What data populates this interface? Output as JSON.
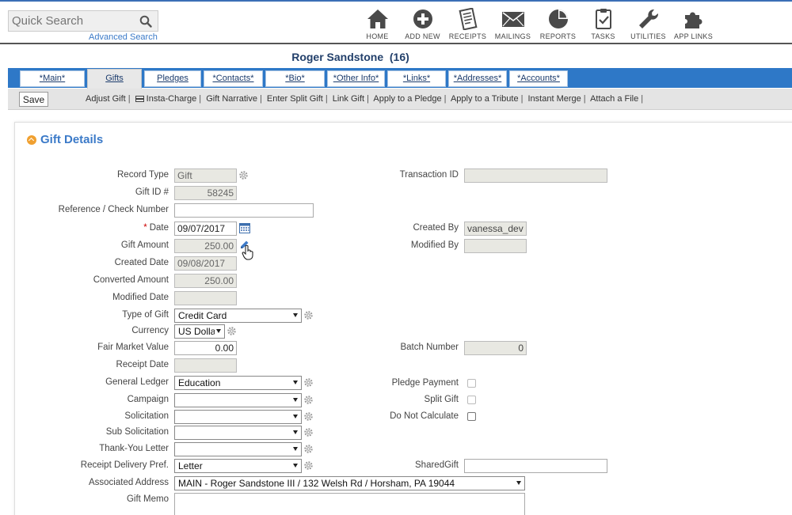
{
  "search": {
    "placeholder": "Quick Search",
    "advanced_link": "Advanced Search"
  },
  "nav": [
    {
      "label": "HOME",
      "icon": "home-icon"
    },
    {
      "label": "ADD NEW",
      "icon": "add-icon"
    },
    {
      "label": "RECEIPTS",
      "icon": "receipt-icon"
    },
    {
      "label": "MAILINGS",
      "icon": "envelope-icon"
    },
    {
      "label": "REPORTS",
      "icon": "pie-chart-icon"
    },
    {
      "label": "TASKS",
      "icon": "clipboard-icon"
    },
    {
      "label": "UTILITIES",
      "icon": "wrench-icon"
    },
    {
      "label": "APP LINKS",
      "icon": "puzzle-icon"
    }
  ],
  "record": {
    "title": "Roger Sandstone  (16)"
  },
  "tabs": [
    {
      "label": "*Main*"
    },
    {
      "label": "Gifts"
    },
    {
      "label": "Pledges"
    },
    {
      "label": "*Contacts*"
    },
    {
      "label": "*Bio*"
    },
    {
      "label": "*Other Info*"
    },
    {
      "label": "*Links*"
    },
    {
      "label": "*Addresses*"
    },
    {
      "label": "*Accounts*"
    }
  ],
  "toolbar": {
    "save_label": "Save",
    "actions": [
      "Adjust Gift",
      "Insta-Charge",
      "Gift Narrative",
      "Enter Split Gift",
      "Link Gift",
      "Apply to a Pledge",
      "Apply to a Tribute",
      "Instant Merge",
      "Attach a File"
    ]
  },
  "panel": {
    "title": "Gift Details",
    "labels": {
      "record_type": "Record Type",
      "gift_id": "Gift ID #",
      "reference": "Reference / Check Number",
      "date_req": "*",
      "date": "Date",
      "gift_amount": "Gift Amount",
      "created_date": "Created Date",
      "converted_amount": "Converted Amount",
      "modified_date": "Modified Date",
      "type_of_gift": "Type of Gift",
      "currency": "Currency",
      "fair_market_value": "Fair Market Value",
      "receipt_date": "Receipt Date",
      "general_ledger": "General Ledger",
      "campaign": "Campaign",
      "solicitation": "Solicitation",
      "sub_solicitation": "Sub Solicitation",
      "thank_you_letter": "Thank-You Letter",
      "receipt_delivery": "Receipt Delivery Pref.",
      "associated_address": "Associated Address",
      "gift_memo": "Gift Memo",
      "transaction_id": "Transaction ID",
      "created_by": "Created By",
      "modified_by": "Modified By",
      "batch_number": "Batch Number",
      "pledge_payment": "Pledge Payment",
      "split_gift": "Split Gift",
      "do_not_calculate": "Do Not Calculate",
      "shared_gift": "SharedGift"
    },
    "values": {
      "record_type": "Gift",
      "gift_id": "58245",
      "reference": "",
      "date": "09/07/2017",
      "gift_amount": "250.00",
      "created_date": "09/08/2017",
      "converted_amount": "250.00",
      "modified_date": "",
      "type_of_gift": "Credit Card",
      "currency": "US Dolla",
      "fair_market_value": "0.00",
      "receipt_date": "",
      "general_ledger": "Education",
      "campaign": "",
      "solicitation": "",
      "sub_solicitation": "",
      "thank_you_letter": "",
      "receipt_delivery": "Letter",
      "associated_address": "MAIN - Roger Sandstone III / 132 Welsh Rd / Horsham, PA 19044",
      "gift_memo": "",
      "transaction_id": "",
      "created_by": "vanessa_dev",
      "modified_by": "",
      "batch_number": "0",
      "shared_gift": ""
    }
  }
}
